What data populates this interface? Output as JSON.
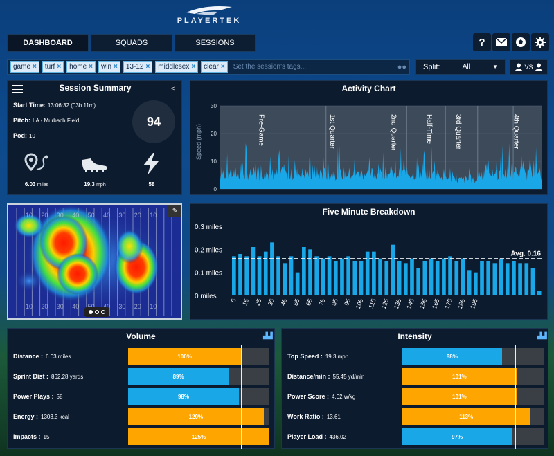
{
  "header": {
    "brand": "PLAYERTEK",
    "nav": [
      {
        "label": "DASHBOARD"
      },
      {
        "label": "SQUADS"
      },
      {
        "label": "SESSIONS"
      }
    ],
    "icons": [
      "question-icon",
      "mail-icon",
      "ball-icon",
      "gear-icon"
    ]
  },
  "tags": {
    "items": [
      "game",
      "turf",
      "home",
      "win",
      "13-12",
      "middlesex",
      "clear"
    ],
    "placeholder": "Set the session's tags...",
    "split_label": "Split:",
    "split_value": "All",
    "vs_label": "VS"
  },
  "session_summary": {
    "title": "Session Summary",
    "start_time_label": "Start Time:",
    "start_time_value": "13:06:32 (03h 11m)",
    "pitch_label": "Pitch:",
    "pitch_value": "LA - Murbach Field",
    "pod_label": "Pod:",
    "pod_value": "10",
    "score": "94",
    "distance_value": "6.03",
    "distance_unit": "miles",
    "speed_value": "19.3",
    "speed_unit": "mph",
    "sprints_value": "58"
  },
  "activity_chart": {
    "title": "Activity Chart",
    "ylabel": "Speed (mph)",
    "yticks": [
      "30",
      "20",
      "10",
      "0"
    ],
    "phases": [
      "Pre-Game",
      "1st Quarter",
      "2nd Quarter",
      "Half-Time",
      "3rd Quarter",
      "4th Quarter"
    ],
    "phase_bounds": [
      0,
      0.33,
      0.58,
      0.7,
      0.8,
      0.91,
      1.0
    ]
  },
  "five_minute": {
    "title": "Five Minute Breakdown",
    "yticks": [
      "0.3 miles",
      "0.2 miles",
      "0.1 miles",
      "0 miles"
    ],
    "avg_label": "Avg. 0.16",
    "avg": 0.16,
    "ymax": 0.3,
    "xticks": [
      "5",
      "15",
      "25",
      "35",
      "45",
      "55",
      "65",
      "75",
      "85",
      "95",
      "105",
      "115",
      "125",
      "135",
      "145",
      "155",
      "165",
      "175",
      "185",
      "195"
    ],
    "values": [
      0.17,
      0.18,
      0.17,
      0.21,
      0.17,
      0.19,
      0.23,
      0.17,
      0.14,
      0.17,
      0.1,
      0.21,
      0.2,
      0.17,
      0.16,
      0.17,
      0.15,
      0.16,
      0.17,
      0.15,
      0.15,
      0.19,
      0.19,
      0.16,
      0.15,
      0.22,
      0.15,
      0.14,
      0.16,
      0.12,
      0.15,
      0.16,
      0.15,
      0.16,
      0.17,
      0.15,
      0.16,
      0.11,
      0.1,
      0.15,
      0.15,
      0.14,
      0.16,
      0.14,
      0.15,
      0.14,
      0.14,
      0.12,
      0.02
    ]
  },
  "volume": {
    "title": "Volume",
    "rows": [
      {
        "label": "Distance :",
        "value": "6.03 miles",
        "pct_label": "100%",
        "pct": 100,
        "color": "#ffa500"
      },
      {
        "label": "Sprint Dist :",
        "value": "862.28 yards",
        "pct_label": "89%",
        "pct": 89,
        "color": "#1aa7e8"
      },
      {
        "label": "Power Plays :",
        "value": "58",
        "pct_label": "98%",
        "pct": 98,
        "color": "#1aa7e8"
      },
      {
        "label": "Energy :",
        "value": "1303.3 kcal",
        "pct_label": "120%",
        "pct": 120,
        "color": "#ffa500"
      },
      {
        "label": "Impacts :",
        "value": "15",
        "pct_label": "125%",
        "pct": 125,
        "color": "#ffa500"
      }
    ]
  },
  "intensity": {
    "title": "Intensity",
    "rows": [
      {
        "label": "Top Speed :",
        "value": "19.3 mph",
        "pct_label": "88%",
        "pct": 88,
        "color": "#1aa7e8"
      },
      {
        "label": "Distance/min :",
        "value": "55.45 yd/min",
        "pct_label": "101%",
        "pct": 101,
        "color": "#ffa500"
      },
      {
        "label": "Power Score :",
        "value": "4.02 w/kg",
        "pct_label": "101%",
        "pct": 101,
        "color": "#ffa500"
      },
      {
        "label": "Work Ratio :",
        "value": "13.61",
        "pct_label": "113%",
        "pct": 113,
        "color": "#ffa500"
      },
      {
        "label": "Player Load :",
        "value": "436.02",
        "pct_label": "97%",
        "pct": 97,
        "color": "#1aa7e8"
      }
    ]
  },
  "heatmap": {
    "yard_labels": [
      "10",
      "20",
      "30",
      "40",
      "50",
      "40",
      "30",
      "20",
      "10"
    ]
  }
}
